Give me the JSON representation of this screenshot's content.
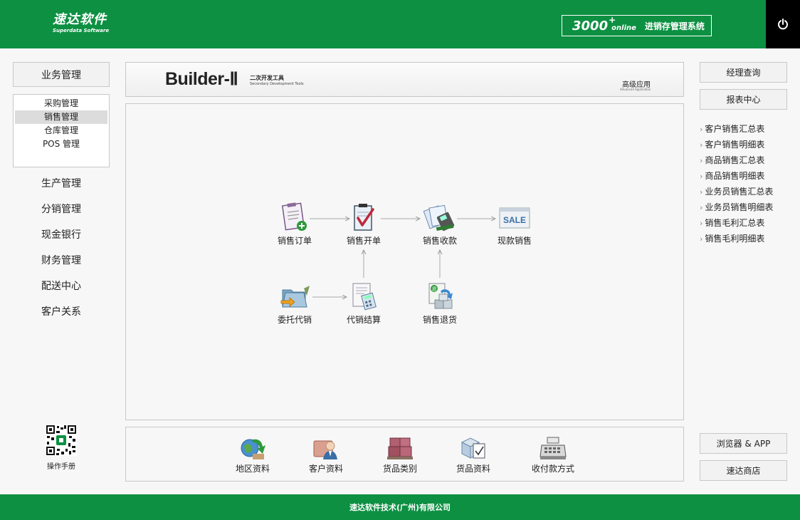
{
  "header": {
    "logo_cn": "速达软件",
    "logo_en": "Superdata Software",
    "product_num": "3000",
    "product_plus": "+",
    "product_online": "online",
    "product_name": "进销存管理系统",
    "brand_color": "#0d9042"
  },
  "left_menu": {
    "head": "业务管理",
    "sub_items": [
      {
        "label": "采购管理",
        "active": false
      },
      {
        "label": "销售管理",
        "active": true
      },
      {
        "label": "仓库管理",
        "active": false
      },
      {
        "label": "POS 管理",
        "active": false
      }
    ],
    "items": [
      "生产管理",
      "分销管理",
      "现金银行",
      "财务管理",
      "配送中心",
      "客户关系"
    ],
    "qr_label": "操作手册"
  },
  "banner": {
    "brand": "Builder-Ⅱ",
    "sub_cn": "二次开发工具",
    "sub_en": "Secondary Development Tools",
    "adv_cn": "高级应用",
    "adv_en": "Advanced Application"
  },
  "flow": {
    "nodes": [
      {
        "id": "order",
        "label": "销售订单",
        "icon": "clipboard-plus-icon"
      },
      {
        "id": "invoice",
        "label": "销售开单",
        "icon": "clipboard-check-icon"
      },
      {
        "id": "receipt",
        "label": "销售收款",
        "icon": "pos-terminal-icon"
      },
      {
        "id": "cash",
        "label": "现款销售",
        "icon": "sale-sign-icon"
      },
      {
        "id": "consign",
        "label": "委托代销",
        "icon": "folder-arrow-icon"
      },
      {
        "id": "settle",
        "label": "代销结算",
        "icon": "calculator-doc-icon"
      },
      {
        "id": "return",
        "label": "销售退货",
        "icon": "return-goods-icon"
      }
    ]
  },
  "bottom": {
    "items": [
      {
        "label": "地区资料",
        "icon": "globe-arrow-icon"
      },
      {
        "label": "客户资料",
        "icon": "customer-icon"
      },
      {
        "label": "货品类别",
        "icon": "boxes-icon"
      },
      {
        "label": "货品资料",
        "icon": "goods-check-icon"
      },
      {
        "label": "收付款方式",
        "icon": "cash-register-icon"
      }
    ]
  },
  "right": {
    "btn_query": "经理查询",
    "btn_report": "报表中心",
    "reports": [
      "客户销售汇总表",
      "客户销售明细表",
      "商品销售汇总表",
      "商品销售明细表",
      "业务员销售汇总表",
      "业务员销售明细表",
      "销售毛利汇总表",
      "销售毛利明细表"
    ],
    "btn_browser": "浏览器 & APP",
    "btn_shop": "速达商店"
  },
  "footer": {
    "text": "速达软件技术(广州)有限公司"
  }
}
